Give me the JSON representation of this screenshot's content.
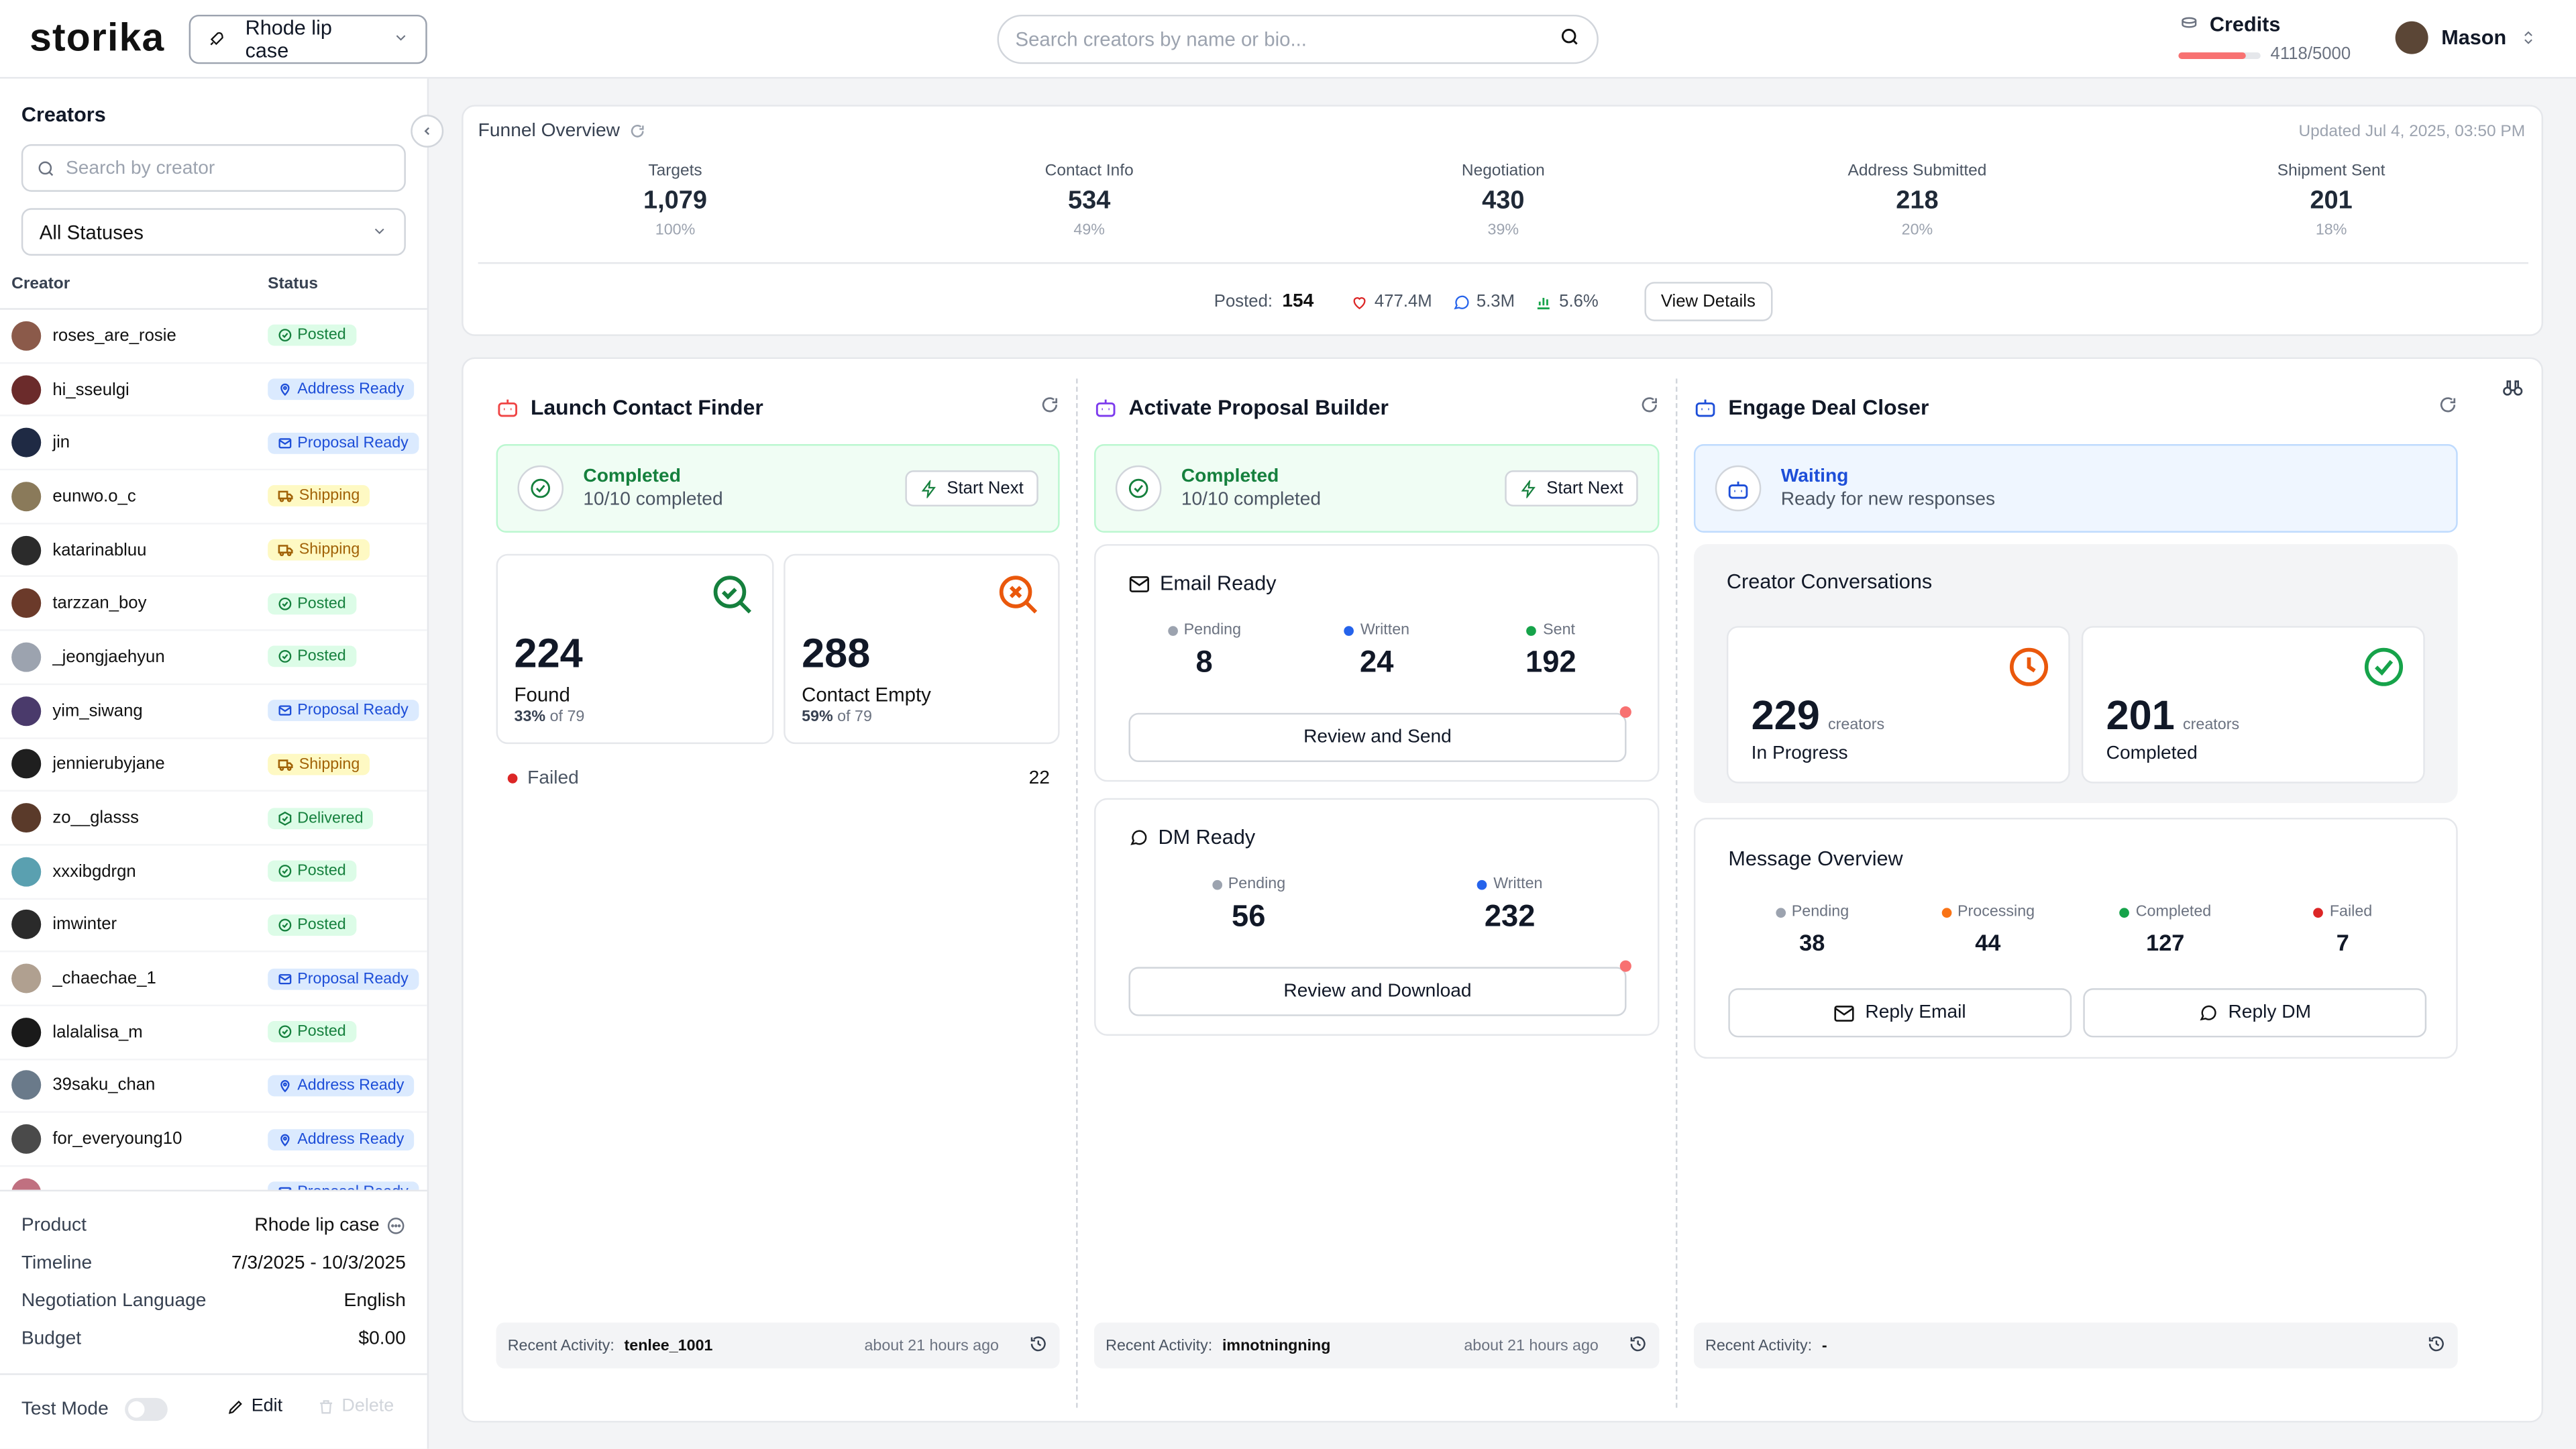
{
  "app": {
    "logo": "storika",
    "campaign": "Rhode lip case"
  },
  "search": {
    "placeholder": "Search creators by name or bio..."
  },
  "credits": {
    "label": "Credits",
    "value": "4118/5000",
    "fraction": 0.8236
  },
  "user": {
    "name": "Mason"
  },
  "sidebar": {
    "title": "Creators",
    "search_placeholder": "Search by creator",
    "filter": "All Statuses",
    "col_creator": "Creator",
    "col_status": "Status",
    "creators": [
      {
        "name": "roses_are_rosie",
        "status": "Posted"
      },
      {
        "name": "hi_sseulgi",
        "status": "Address Ready"
      },
      {
        "name": "jin",
        "status": "Proposal Ready"
      },
      {
        "name": "eunwo.o_c",
        "status": "Shipping"
      },
      {
        "name": "katarinabluu",
        "status": "Shipping"
      },
      {
        "name": "tarzzan_boy",
        "status": "Posted"
      },
      {
        "name": "_jeongjaehyun",
        "status": "Posted"
      },
      {
        "name": "yim_siwang",
        "status": "Proposal Ready"
      },
      {
        "name": "jennierubyjane",
        "status": "Shipping"
      },
      {
        "name": "zo__glasss",
        "status": "Delivered"
      },
      {
        "name": "xxxibgdrgn",
        "status": "Posted"
      },
      {
        "name": "imwinter",
        "status": "Posted"
      },
      {
        "name": "_chaechae_1",
        "status": "Proposal Ready"
      },
      {
        "name": "lalalalisa_m",
        "status": "Posted"
      },
      {
        "name": "39saku_chan",
        "status": "Address Ready"
      },
      {
        "name": "for_everyoung10",
        "status": "Address Ready"
      },
      {
        "name": "",
        "status": "Proposal Ready"
      }
    ],
    "info": {
      "product_label": "Product",
      "product": "Rhode lip case",
      "timeline_label": "Timeline",
      "timeline": "7/3/2025 - 10/3/2025",
      "language_label": "Negotiation Language",
      "language": "English",
      "budget_label": "Budget",
      "budget": "$0.00"
    },
    "test_mode": "Test Mode",
    "edit": "Edit",
    "delete": "Delete"
  },
  "funnel": {
    "title": "Funnel Overview",
    "updated": "Updated Jul 4, 2025, 03:50 PM",
    "stages": [
      {
        "label": "Targets",
        "value": "1,079",
        "pct": "100%"
      },
      {
        "label": "Contact Info",
        "value": "534",
        "pct": "49%"
      },
      {
        "label": "Negotiation",
        "value": "430",
        "pct": "39%"
      },
      {
        "label": "Address Submitted",
        "value": "218",
        "pct": "20%"
      },
      {
        "label": "Shipment Sent",
        "value": "201",
        "pct": "18%"
      }
    ],
    "posted_label": "Posted:",
    "posted": "154",
    "likes": "477.4M",
    "comments": "5.3M",
    "engagement": "5.6%",
    "view_details": "View Details"
  },
  "contact_finder": {
    "title": "Launch Contact Finder",
    "status": "Completed",
    "status_sub": "10/10 completed",
    "start": "Start Next",
    "found": "224",
    "found_label": "Found",
    "found_pct": "33%",
    "found_of": "of 79",
    "empty": "288",
    "empty_label": "Contact Empty",
    "empty_pct": "59%",
    "empty_of": "of 79",
    "failed_label": "Failed",
    "failed": "22",
    "activity_label": "Recent Activity:",
    "activity_user": "tenlee_1001",
    "activity_when": "about 21 hours ago"
  },
  "proposal_builder": {
    "title": "Activate Proposal Builder",
    "status": "Completed",
    "status_sub": "10/10 completed",
    "start": "Start Next",
    "email_title": "Email Ready",
    "email_pending_label": "Pending",
    "email_pending": "8",
    "email_written_label": "Written",
    "email_written": "24",
    "email_sent_label": "Sent",
    "email_sent": "192",
    "email_btn": "Review and Send",
    "dm_title": "DM Ready",
    "dm_pending_label": "Pending",
    "dm_pending": "56",
    "dm_written_label": "Written",
    "dm_written": "232",
    "dm_btn": "Review and Download",
    "activity_label": "Recent Activity:",
    "activity_user": "imnotningning",
    "activity_when": "about 21 hours ago"
  },
  "deal_closer": {
    "title": "Engage Deal Closer",
    "status": "Waiting",
    "status_sub": "Ready for new responses",
    "conv_title": "Creator Conversations",
    "in_progress": "229",
    "in_progress_unit": "creators",
    "in_progress_label": "In Progress",
    "completed": "201",
    "completed_unit": "creators",
    "completed_label": "Completed",
    "msg_title": "Message Overview",
    "msg": [
      {
        "label": "Pending",
        "value": "38"
      },
      {
        "label": "Processing",
        "value": "44"
      },
      {
        "label": "Completed",
        "value": "127"
      },
      {
        "label": "Failed",
        "value": "7"
      }
    ],
    "reply_email": "Reply Email",
    "reply_dm": "Reply DM",
    "activity_label": "Recent Activity:",
    "activity_user": "-"
  },
  "colors": {
    "posted": "#15803d",
    "ready": "#1d4ed8",
    "shipping": "#a16207",
    "accent_red": "#dc2626"
  }
}
